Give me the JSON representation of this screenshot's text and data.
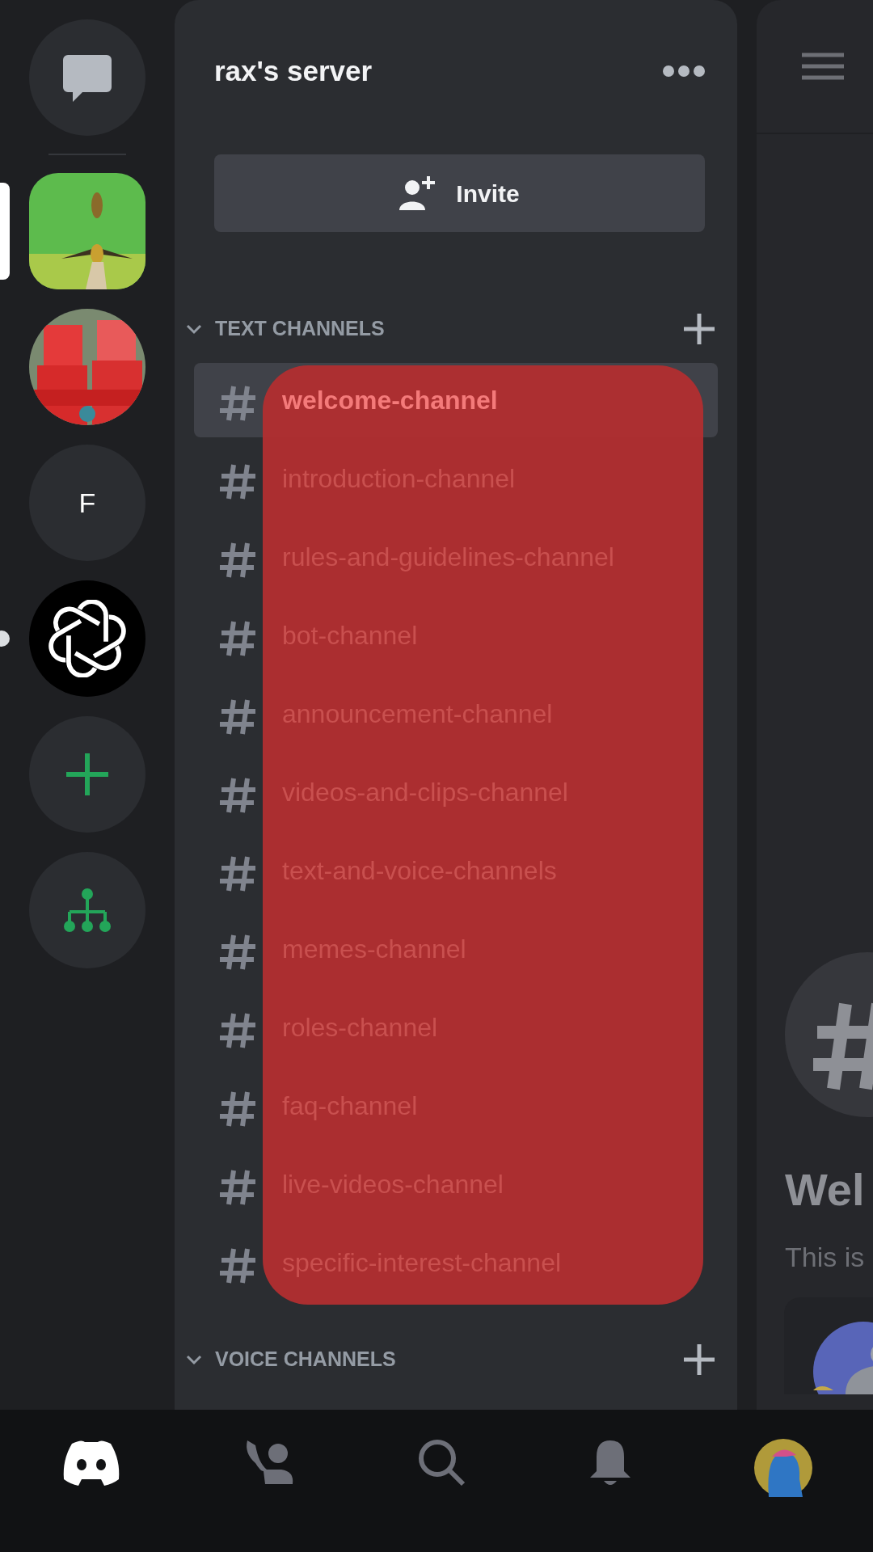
{
  "servers": [
    {
      "kind": "dm",
      "selected": false,
      "unread": false
    },
    {
      "kind": "picture",
      "selected": true,
      "unread": false
    },
    {
      "kind": "picture",
      "selected": false,
      "unread": false
    },
    {
      "kind": "letter",
      "label": "F",
      "selected": false,
      "unread": false
    },
    {
      "kind": "knot",
      "selected": false,
      "unread": true
    },
    {
      "kind": "add",
      "selected": false,
      "unread": false
    },
    {
      "kind": "explore",
      "selected": false,
      "unread": false
    }
  ],
  "server": {
    "title": "rax's server",
    "invite_label": "Invite"
  },
  "categories": [
    {
      "title": "TEXT CHANNELS",
      "expanded": true,
      "channels": [
        {
          "name": "welcome-channel",
          "selected": true
        },
        {
          "name": "introduction-channel",
          "selected": false
        },
        {
          "name": "rules-and-guidelines-channel",
          "selected": false
        },
        {
          "name": "bot-channel",
          "selected": false
        },
        {
          "name": "announcement-channel",
          "selected": false
        },
        {
          "name": "videos-and-clips-channel",
          "selected": false
        },
        {
          "name": "text-and-voice-channels",
          "selected": false
        },
        {
          "name": "memes-channel",
          "selected": false
        },
        {
          "name": "roles-channel",
          "selected": false
        },
        {
          "name": "faq-channel",
          "selected": false
        },
        {
          "name": "live-videos-channel",
          "selected": false
        },
        {
          "name": "specific-interest-channel",
          "selected": false
        }
      ]
    },
    {
      "title": "VOICE CHANNELS",
      "expanded": true
    }
  ],
  "chat": {
    "welcome_title": "Wel",
    "welcome_text": "This is"
  },
  "bottom_nav": [
    {
      "kind": "home",
      "selected": true
    },
    {
      "kind": "friends",
      "selected": false
    },
    {
      "kind": "search",
      "selected": false
    },
    {
      "kind": "notifications",
      "selected": false
    },
    {
      "kind": "profile",
      "selected": false
    }
  ]
}
